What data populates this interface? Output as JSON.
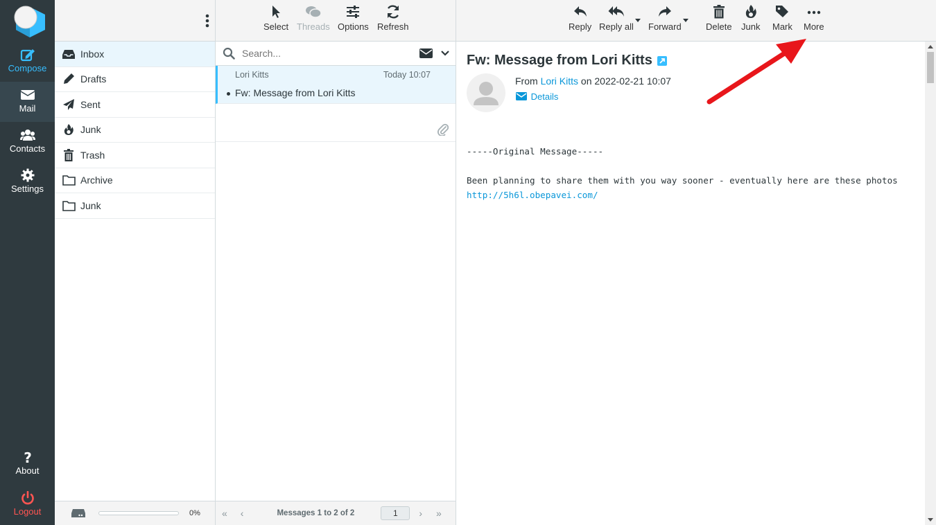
{
  "nav": {
    "compose": "Compose",
    "mail": "Mail",
    "contacts": "Contacts",
    "settings": "Settings",
    "about": "About",
    "logout": "Logout"
  },
  "folders": [
    {
      "name": "Inbox",
      "icon": "inbox-icon"
    },
    {
      "name": "Drafts",
      "icon": "pencil-icon"
    },
    {
      "name": "Sent",
      "icon": "paper-plane-icon"
    },
    {
      "name": "Junk",
      "icon": "fire-icon"
    },
    {
      "name": "Trash",
      "icon": "trash-icon"
    },
    {
      "name": "Archive",
      "icon": "folder-icon"
    },
    {
      "name": "Junk",
      "icon": "folder-icon"
    }
  ],
  "quota": {
    "percent": "0%"
  },
  "list_toolbar": {
    "select": "Select",
    "threads": "Threads",
    "options": "Options",
    "refresh": "Refresh"
  },
  "search": {
    "placeholder": "Search..."
  },
  "messages": [
    {
      "from": "Lori Kitts",
      "date": "Today 10:07",
      "subject": "Fw: Message from Lori Kitts",
      "unread": true,
      "attachment": true
    }
  ],
  "list_footer": {
    "count": "Messages 1 to 2 of 2",
    "page": "1"
  },
  "reader_toolbar": {
    "reply": "Reply",
    "reply_all": "Reply all",
    "forward": "Forward",
    "delete": "Delete",
    "junk": "Junk",
    "mark": "Mark",
    "more": "More"
  },
  "message": {
    "subject": "Fw: Message from Lori Kitts",
    "from_prefix": "From",
    "from_name": "Lori Kitts",
    "date_text": "on 2022-02-21 10:07",
    "details": "Details",
    "body_line1": "-----Original Message-----",
    "body_line2": "Been planning to share them with you way sooner - eventually here are these photos",
    "body_link": "http://5h6l.obepavei.com/"
  },
  "colors": {
    "accent": "#37beff",
    "nav_bg": "#2f3a3f",
    "link": "#0a97d9",
    "logout": "#ff5552",
    "annotation_arrow": "#e8161b"
  }
}
